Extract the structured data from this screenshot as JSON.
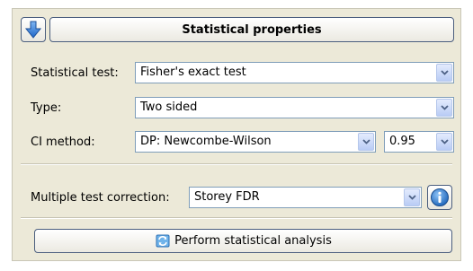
{
  "panel": {
    "title": "Statistical properties",
    "collapse_icon": "arrow-down-icon"
  },
  "statistical_test": {
    "label": "Statistical test:",
    "value": "Fisher's exact test"
  },
  "type": {
    "label": "Type:",
    "value": "Two sided"
  },
  "ci_method": {
    "label": "CI method:",
    "value": "DP: Newcombe-Wilson",
    "confidence_value": "0.95"
  },
  "multiple_test_correction": {
    "label": "Multiple test correction:",
    "value": "Storey FDR",
    "info_icon": "info-icon"
  },
  "perform_button": {
    "label": "Perform statistical analysis",
    "icon": "refresh-icon"
  },
  "colors": {
    "panel_bg": "#ece9d8",
    "combo_border": "#7f9db9",
    "button_border": "#4b5e7e",
    "icon_blue": "#2f7fd6"
  }
}
